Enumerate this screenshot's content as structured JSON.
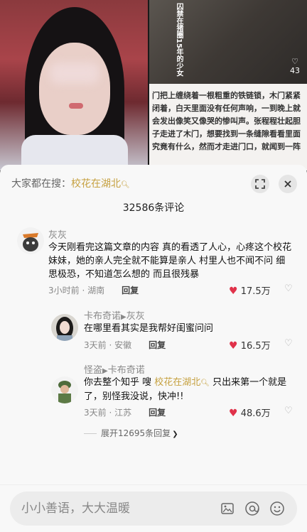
{
  "background": {
    "right_card": {
      "tag": "囚禁在猪圈15年的少女",
      "likes": "43",
      "story": "门把上缠绕着一根粗重的铁链锁，木门紧紧闭着，白天里面没有任何声响，一到晚上就会发出像笑又像哭的惨叫声。张程程壮起胆子走进了木门，想要找到一条缝隙看看里面究竟有什么，然而才走进门口，就闻到一阵"
    }
  },
  "sheet": {
    "search_prefix": "大家都在搜：",
    "search_keyword": "校花在湖北",
    "comment_count": "32586条评论",
    "icons": {
      "expand": "expand-icon",
      "close": "close-icon"
    }
  },
  "comments": [
    {
      "user": "灰灰",
      "text": "今天刚看完这篇文章的内容 真的看透了人心，心疼这个校花妹妹，她的亲人完全就不能算是亲人 村里人也不闻不问 细思极恐，不知道怎么想的 而且很残暴",
      "time": "3小时前",
      "location": "湖南",
      "reply": "回复",
      "likes": "17.5万"
    },
    {
      "user": "卡布奇诺",
      "reply_to": "灰灰",
      "text": "在哪里看其实是我帮好闺蜜问问",
      "time": "3天前",
      "location": "安徽",
      "reply": "回复",
      "likes": "16.5万"
    },
    {
      "user": "怪盗",
      "reply_to": "卡布奇诺",
      "text_before": "你去整个知乎 嗖 ",
      "keyword": "校花在湖北",
      "text_after": " 只出来第一个就是了，别怪我没说，快冲!!",
      "time": "3天前",
      "location": "江苏",
      "reply": "回复",
      "likes": "48.6万"
    }
  ],
  "expand_replies": "展开12695条回复",
  "input": {
    "placeholder": "小小善语，大大温暖"
  },
  "colors": {
    "accent": "#c6a140",
    "heart": "#e0324a"
  }
}
